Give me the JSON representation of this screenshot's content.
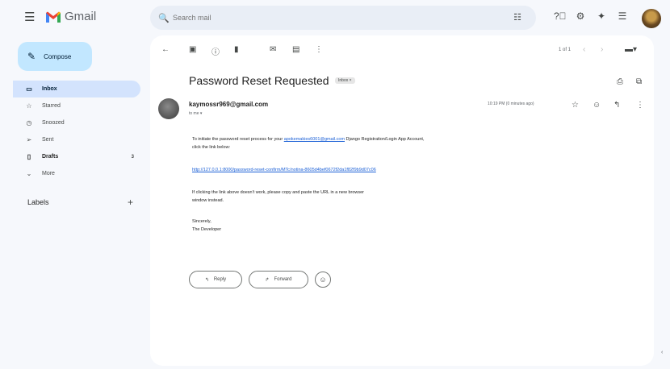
{
  "header": {
    "app_name": "Gmail",
    "search_placeholder": "Search mail"
  },
  "sidebar": {
    "compose_label": "Compose",
    "items": [
      {
        "label": "Inbox",
        "icon": "inbox-icon"
      },
      {
        "label": "Starred",
        "icon": "star-icon"
      },
      {
        "label": "Snoozed",
        "icon": "clock-icon"
      },
      {
        "label": "Sent",
        "icon": "send-icon"
      },
      {
        "label": "Drafts",
        "icon": "draft-icon",
        "count": "3"
      },
      {
        "label": "More",
        "icon": "chevron-down-icon"
      }
    ],
    "labels_heading": "Labels"
  },
  "toolbar": {
    "pager": "1 of 1"
  },
  "email": {
    "subject": "Password Reset Requested",
    "folder_badge": "Inbox ×",
    "sender": "kaymossr969@gmail.com",
    "to": "to me ▾",
    "timestamp": "10:19 PM (0 minutes ago)",
    "para1_prefix": "To initiate the password reset process for your ",
    "para1_link": "apokemakies6001@gmail.com",
    "para1_suffix": " Django Registration/Login App Account,",
    "para1_line2": "click the link below:",
    "reset_link": "http://127.0.0.1:8000/password-reset-confirm/MTc/notina-8605d4bef0672f2da1f82f9b9d07c06",
    "para2_line1": "If clicking the link above doesn't work, please copy and paste the URL in a new browser",
    "para2_line2": "window instead.",
    "signoff": "Sincerely,",
    "signature": "The Developer"
  },
  "actions": {
    "reply": "Reply",
    "forward": "Forward"
  }
}
